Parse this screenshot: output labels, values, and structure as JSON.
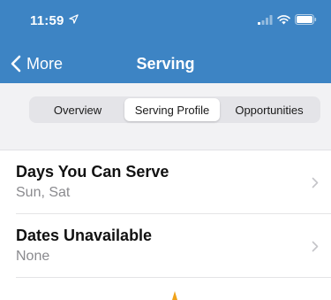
{
  "status_bar": {
    "time": "11:59"
  },
  "nav": {
    "back_label": "More",
    "title": "Serving"
  },
  "segments": [
    {
      "label": "Overview",
      "active": false
    },
    {
      "label": "Serving Profile",
      "active": true
    },
    {
      "label": "Opportunities",
      "active": false
    }
  ],
  "rows": [
    {
      "title": "Days You Can Serve",
      "subtitle": "Sun, Sat"
    },
    {
      "title": "Dates Unavailable",
      "subtitle": "None"
    }
  ],
  "colors": {
    "header": "#3d84c4",
    "spinner": "#f0a21a"
  }
}
